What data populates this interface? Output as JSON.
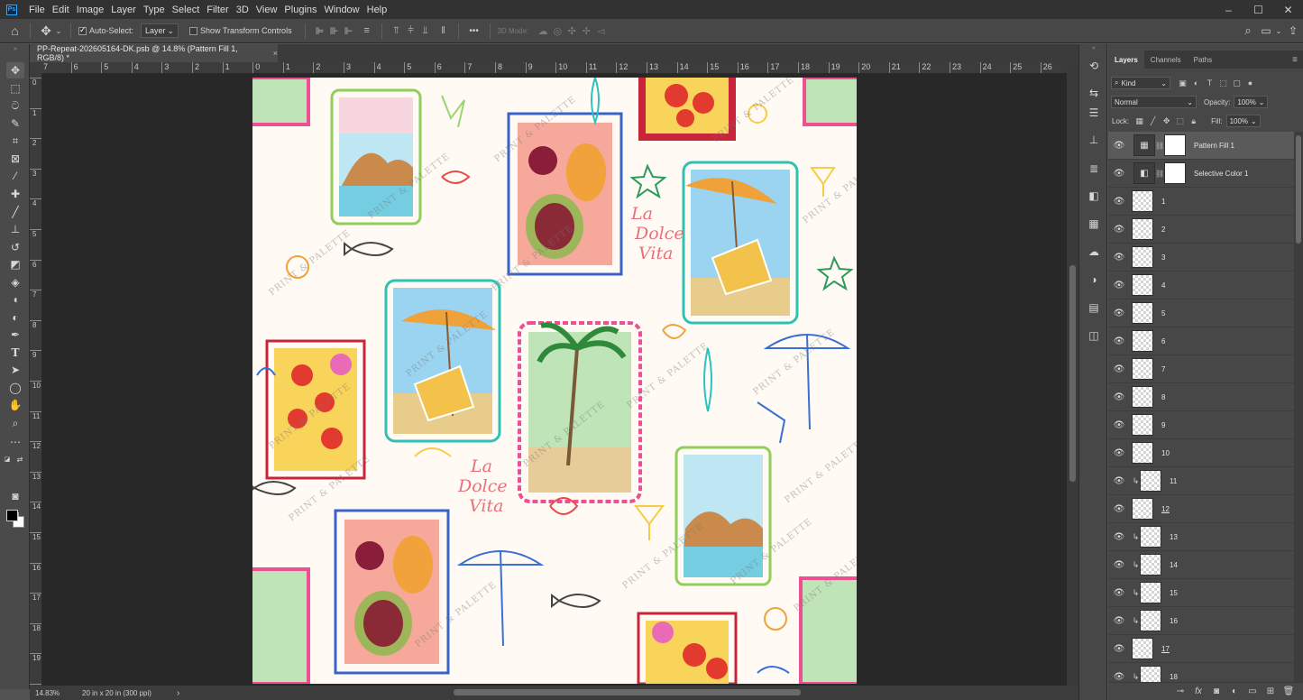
{
  "app": {
    "logo_text": "Ps",
    "menu": [
      "File",
      "Edit",
      "Image",
      "Layer",
      "Type",
      "Select",
      "Filter",
      "3D",
      "View",
      "Plugins",
      "Window",
      "Help"
    ],
    "window_controls": [
      "–",
      "☐",
      "✕"
    ]
  },
  "options_bar": {
    "auto_select_label": "Auto-Select:",
    "auto_select_checked": true,
    "auto_select_target": "Layer",
    "show_transform_label": "Show Transform Controls",
    "show_transform_checked": false,
    "more_label": "•••",
    "mode_3d_label": "3D Mode:"
  },
  "document": {
    "tab_title": "PP-Repeat-202605164-DK.psb @ 14.8% (Pattern Fill 1, RGB/8) *",
    "close_glyph": "×",
    "zoom": "14.83%",
    "doc_info": "20 in x 20 in (300 ppi)",
    "status_arrow": "›"
  },
  "rulers": {
    "horizontal": [
      "7",
      "6",
      "5",
      "4",
      "3",
      "2",
      "1",
      "0",
      "1",
      "2",
      "3",
      "4",
      "5",
      "6",
      "7",
      "8",
      "9",
      "10",
      "11",
      "12",
      "13",
      "14",
      "15",
      "16",
      "17",
      "18",
      "19",
      "20",
      "21",
      "22",
      "23",
      "24",
      "25",
      "26"
    ],
    "vertical": [
      "0",
      "1",
      "2",
      "3",
      "4",
      "5",
      "6",
      "7",
      "8",
      "9",
      "10",
      "11",
      "12",
      "13",
      "14",
      "15",
      "16",
      "17",
      "18",
      "19",
      "20"
    ]
  },
  "artwork": {
    "watermark": "PRINT & PALETTE",
    "slogan": [
      "La",
      "Dolce",
      "Vita"
    ]
  },
  "layers_panel": {
    "tabs": [
      "Layers",
      "Channels",
      "Paths"
    ],
    "active_tab": "Layers",
    "filter_label": "Kind",
    "blend_mode": "Normal",
    "opacity_label": "Opacity:",
    "opacity_value": "100%",
    "lock_label": "Lock:",
    "fill_label": "Fill:",
    "fill_value": "100%",
    "layers": [
      {
        "name": "Pattern Fill 1",
        "kind": "fill",
        "selected": true
      },
      {
        "name": "Selective Color 1",
        "kind": "adjustment"
      },
      {
        "name": "1",
        "kind": "pixel"
      },
      {
        "name": "2",
        "kind": "pixel"
      },
      {
        "name": "3",
        "kind": "pixel"
      },
      {
        "name": "4",
        "kind": "pixel"
      },
      {
        "name": "5",
        "kind": "pixel"
      },
      {
        "name": "6",
        "kind": "pixel"
      },
      {
        "name": "7",
        "kind": "pixel"
      },
      {
        "name": "8",
        "kind": "pixel"
      },
      {
        "name": "9",
        "kind": "pixel"
      },
      {
        "name": "10",
        "kind": "pixel"
      },
      {
        "name": "11",
        "kind": "clipped"
      },
      {
        "name": "12",
        "kind": "pixel",
        "underline": true
      },
      {
        "name": "13",
        "kind": "clipped"
      },
      {
        "name": "14",
        "kind": "clipped"
      },
      {
        "name": "15",
        "kind": "clipped"
      },
      {
        "name": "16",
        "kind": "clipped"
      },
      {
        "name": "17",
        "kind": "pixel",
        "underline": true
      },
      {
        "name": "18",
        "kind": "clipped"
      }
    ]
  }
}
